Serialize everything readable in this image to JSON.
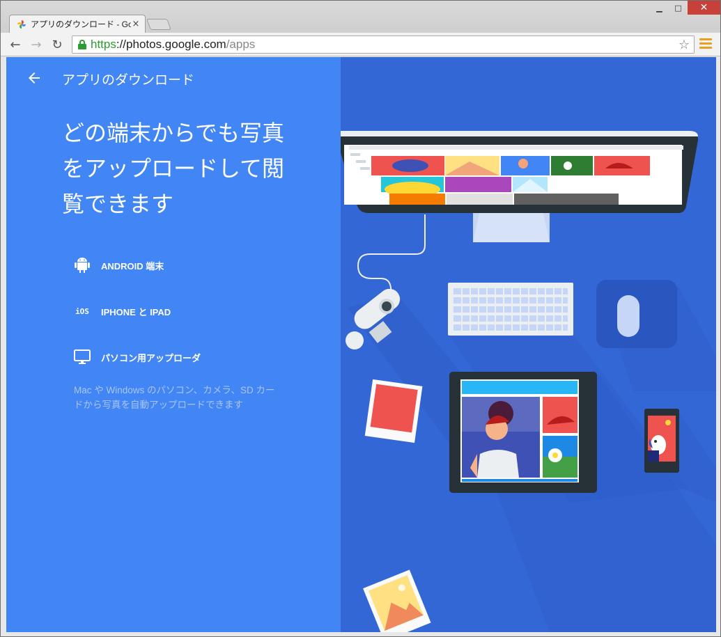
{
  "window": {
    "tab_title": "アプリのダウンロード - Google",
    "tab_close": "×",
    "minimize": "▁",
    "maximize": "□",
    "close": "✕"
  },
  "toolbar": {
    "back": "←",
    "forward": "→",
    "reload": "↻",
    "url_scheme": "https",
    "url_host": "://photos.google.com",
    "url_path": "/apps",
    "star": "☆"
  },
  "appbar": {
    "back_icon": "arrow-left-icon",
    "title": "アプリのダウンロード"
  },
  "headline": "どの端末からでも写真をアップロードして閲覧できます",
  "options": [
    {
      "icon": "android-icon",
      "label": "ANDROID 端末"
    },
    {
      "icon": "ios-icon",
      "icon_text": "iOS",
      "label": "IPHONE と IPAD"
    },
    {
      "icon": "monitor-icon",
      "label": "パソコン用アップローダ"
    }
  ],
  "description": "Mac や Windows のパソコン、カメラ、SD カードから写真を自動アップロードできます",
  "colors": {
    "left_panel": "#4285f4",
    "right_panel": "#3367d6",
    "secure_green": "#2c9b30"
  }
}
